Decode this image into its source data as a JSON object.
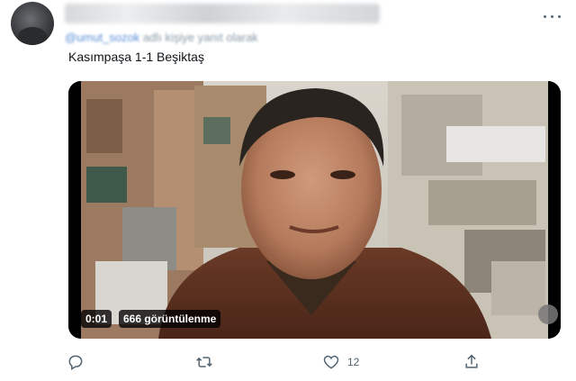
{
  "tweet": {
    "author_display_name": "",
    "reply_handle": "@umut_sozok",
    "reply_suffix": " adlı kişiye yanıt olarak",
    "text": "Kasımpaşa 1-1 Beşiktaş"
  },
  "video": {
    "elapsed": "0:01",
    "views": "666 görüntülenme"
  },
  "actions": {
    "reply_count": "",
    "retweet_count": "",
    "like_count": "12"
  },
  "icons": {
    "more": "more-horizontal-icon",
    "reply": "reply-icon",
    "retweet": "retweet-icon",
    "like": "heart-icon",
    "share": "share-icon",
    "mute": "volume-icon"
  },
  "colors": {
    "text": "#0f1419",
    "muted": "#536471",
    "link": "#1d9bf0"
  }
}
